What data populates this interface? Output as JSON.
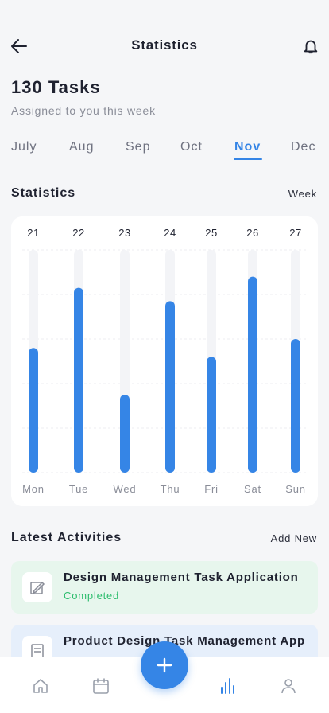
{
  "header": {
    "title": "Statistics",
    "back_icon": "arrow-left-icon",
    "bell_icon": "bell-icon"
  },
  "summary": {
    "tasks_title": "130 Tasks",
    "tasks_subtitle": "Assigned to you this week"
  },
  "months": {
    "items": [
      "July",
      "Aug",
      "Sep",
      "Oct",
      "Nov",
      "Dec"
    ],
    "selected": "Nov"
  },
  "statistics_section": {
    "title": "Statistics",
    "period": "Week"
  },
  "chart_data": {
    "type": "bar",
    "categories": [
      "Mon",
      "Tue",
      "Wed",
      "Thu",
      "Fri",
      "Sat",
      "Sun"
    ],
    "top_labels": [
      "21",
      "22",
      "23",
      "24",
      "25",
      "26",
      "27"
    ],
    "values": [
      56,
      83,
      35,
      77,
      52,
      88,
      60
    ],
    "ylim": [
      0,
      100
    ],
    "grid": true,
    "bar_color": "#3585e6",
    "track_color": "#f3f4f7"
  },
  "activities_section": {
    "title": "Latest Activities",
    "add_label": "Add New",
    "items": [
      {
        "title": "Design Management Task Application",
        "status": "Completed",
        "status_color": "#2ebd6e",
        "bg_color": "#e7f6ed",
        "icon": "edit-document-icon"
      },
      {
        "title": "Product Design Task Management App",
        "status": "",
        "bg_color": "#e6effb",
        "icon": "document-icon"
      }
    ]
  },
  "bottom_nav": {
    "items": [
      "home-icon",
      "calendar-icon",
      "stats-icon",
      "profile-icon"
    ],
    "active": "stats-icon",
    "fab_icon": "plus-icon",
    "accent": "#3585e6",
    "inactive_color": "#9aa0ab"
  }
}
